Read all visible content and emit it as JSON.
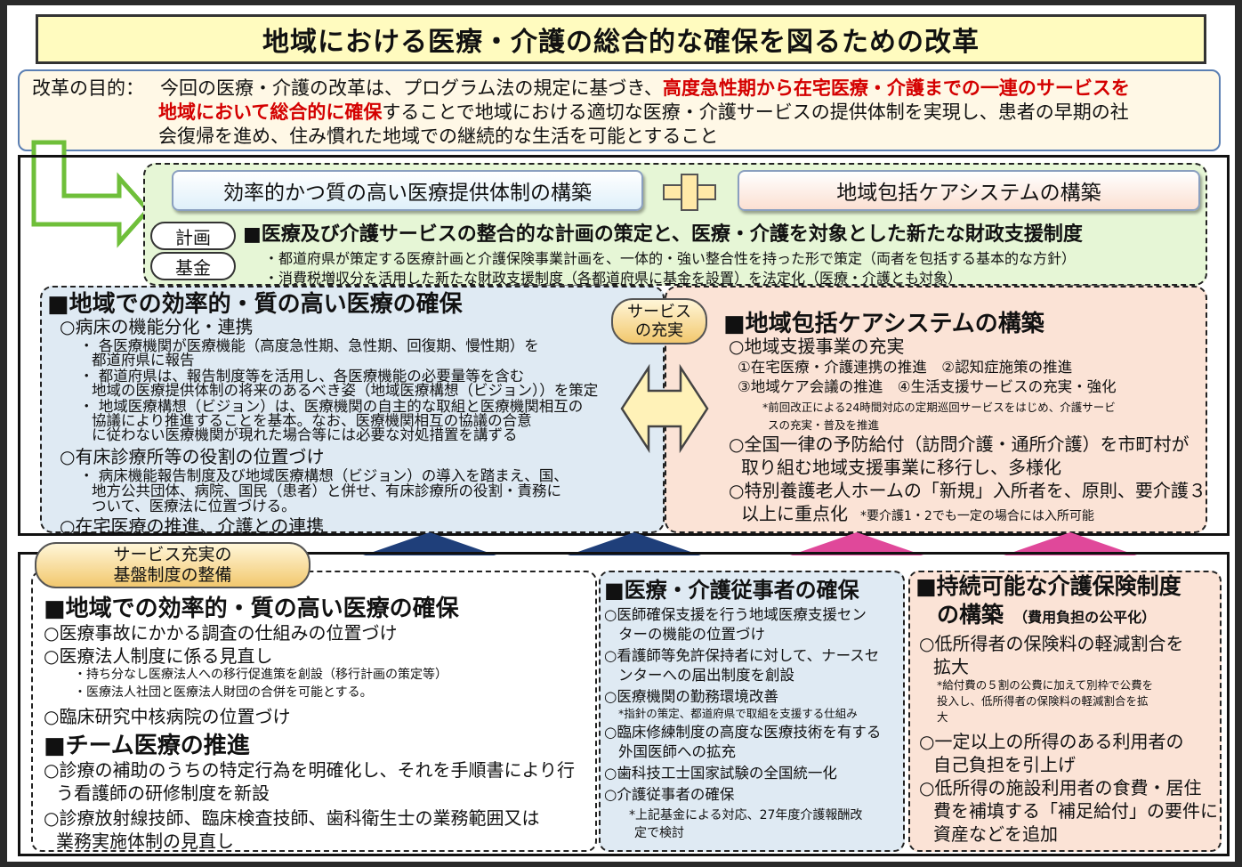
{
  "title": "地域における医療・介護の総合的な確保を図るための改革",
  "purpose": {
    "label": "改革の目的：",
    "text1": "今回の医療・介護の改革は、プログラム法の規定に基づき、",
    "red1": "高度急性期から在宅医療・介護までの一連のサービスを",
    "red2": "地域において総合的に確保",
    "text2": "することで地域における適切な医療・介護サービスの提供体制を実現し、患者の早期の社",
    "text3": "会復帰を進め、住み慣れた地域での継続的な生活を可能とすること"
  },
  "goals": {
    "left": "効率的かつ質の高い医療提供体制の構築",
    "right": "地域包括ケアシステムの構築"
  },
  "plan": {
    "pill1": "計画",
    "pill2": "基金",
    "heading": "■医療及び介護サービスの整合的な計画の策定と、医療・介護を対象とした新たな財政支援制度",
    "line1": "・都道府県が策定する医療計画と介護保険事業計画を、一体的・強い整合性を持った形で策定（両者を包括する基本的な方針）",
    "line2": "・消費税増収分を活用した新たな財政支援制度（各都道府県に基金を設置）を法定化（医療・介護とも対象）"
  },
  "service_oval": [
    "サービス",
    "の充実"
  ],
  "upper_left": {
    "heading": "■地域での効率的・質の高い医療の確保",
    "lines": [
      "○病床の機能分化・連携",
      "・ 各医療機関が医療機能（高度急性期、急性期、回復期、慢性期）を",
      "都道府県に報告",
      "・ 都道府県は、報告制度等を活用し、各医療機能の必要量等を含む",
      "地域の医療提供体制の将来のあるべき姿（地域医療構想（ビジョン））を策定",
      "・ 地域医療構想（ビジョン）は、医療機関の自主的な取組と医療機関相互の",
      "協議により推進することを基本。なお、医療機関相互の協議の合意",
      "に従わない医療機関が現れた場合等には必要な対処措置を講ずる",
      "○有床診療所等の役割の位置づけ",
      "・ 病床機能報告制度及び地域医療構想（ビジョン）の導入を踏まえ、国、",
      "地方公共団体、病院、国民（患者）と併せ、有床診療所の役割・責務に",
      "ついて、医療法に位置づける。",
      "○在宅医療の推進、介護との連携"
    ]
  },
  "upper_right": {
    "heading": "■地域包括ケアシステムの構築",
    "lines": [
      "○地域支援事業の充実",
      "①在宅医療・介護連携の推進　②認知症施策の推進",
      "③地域ケア会議の推進　④生活支援サービスの充実・強化",
      "*前回改正による24時間対応の定期巡回サービスをはじめ、介護サービ",
      "スの充実・普及を推進",
      "○全国一律の予防給付（訪問介護・通所介護）を市町村が",
      "取り組む地域支援事業に移行し、多様化",
      "○特別養護老人ホームの「新規」入所者を、原則、要介護３",
      "以上に重点化",
      "*要介護1・2でも一定の場合には入所可能"
    ]
  },
  "foundation_oval": [
    "サービス充実の",
    "基盤制度の整備"
  ],
  "lower_left": {
    "heading1": "■地域での効率的・質の高い医療の確保",
    "lines1": [
      "○医療事故にかかる調査の仕組みの位置づけ",
      "○医療法人制度に係る見直し",
      "・持ち分なし医療法人への移行促進策を創設（移行計画の策定等）",
      "・医療法人社団と医療法人財団の合併を可能とする。",
      "○臨床研究中核病院の位置づけ"
    ],
    "heading2": "■チーム医療の推進",
    "lines2": [
      "○診療の補助のうちの特定行為を明確化し、それを手順書により行",
      "う看護師の研修制度を新設",
      "○診療放射線技師、臨床検査技師、歯科衛生士の業務範囲又は",
      "業務実施体制の見直し"
    ]
  },
  "lower_mid": {
    "heading": "■医療・介護従事者の確保",
    "lines": [
      "○医師確保支援を行う地域医療支援セン",
      "ターの機能の位置づけ",
      "○看護師等免許保持者に対して、ナースセ",
      "ンターへの届出制度を創設",
      "○医療機関の勤務環境改善",
      "*指針の策定、都道府県で取組を支援する仕組み",
      "○臨床修練制度の高度な医療技術を有する",
      "外国医師への拡充",
      "○歯科技工士国家試験の全国統一化",
      "○介護従事者の確保",
      "*上記基金による対応、27年度介護報酬改",
      "定で検討"
    ]
  },
  "lower_right": {
    "heading1": "■持続可能な介護保険制度",
    "heading2": "の構築",
    "heading_note": "（費用負担の公平化）",
    "lines": [
      "○低所得者の保険料の軽減割合を",
      "拡大",
      "*給付費の５割の公費に加えて別枠で公費を",
      "投入し、低所得者の保険料の軽減割合を拡",
      "大",
      "○一定以上の所得のある利用者の",
      "自己負担を引上げ",
      "○低所得の施設利用者の食費・居住",
      "費を補填する「補足給付」の要件に",
      "資産などを追加"
    ]
  },
  "colors": {
    "title_bg": "#fffbbf",
    "highlight_red": "#d40000",
    "green_box": "#e6f6d6",
    "blue_box": "#dfeaf3",
    "pink_box": "#fbe3d6",
    "arrow_navy": "#1f3f7a",
    "arrow_magenta": "#e0489a"
  }
}
